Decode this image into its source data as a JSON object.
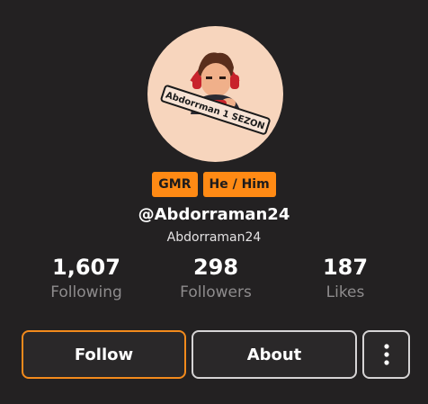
{
  "profile": {
    "avatar_logo_text": "Abdorrman 1 SEZON",
    "badges": [
      "GMR",
      "He / Him"
    ],
    "handle": "@Abdorraman24",
    "display_name": "Abdorraman24"
  },
  "stats": [
    {
      "value": "1,607",
      "label": "Following"
    },
    {
      "value": "298",
      "label": "Followers"
    },
    {
      "value": "187",
      "label": "Likes"
    }
  ],
  "actions": {
    "follow_label": "Follow",
    "about_label": "About",
    "more_icon": "more-vertical-icon"
  },
  "colors": {
    "background": "#232122",
    "accent": "#ff8a14",
    "follow_border": "#f28a1c"
  }
}
